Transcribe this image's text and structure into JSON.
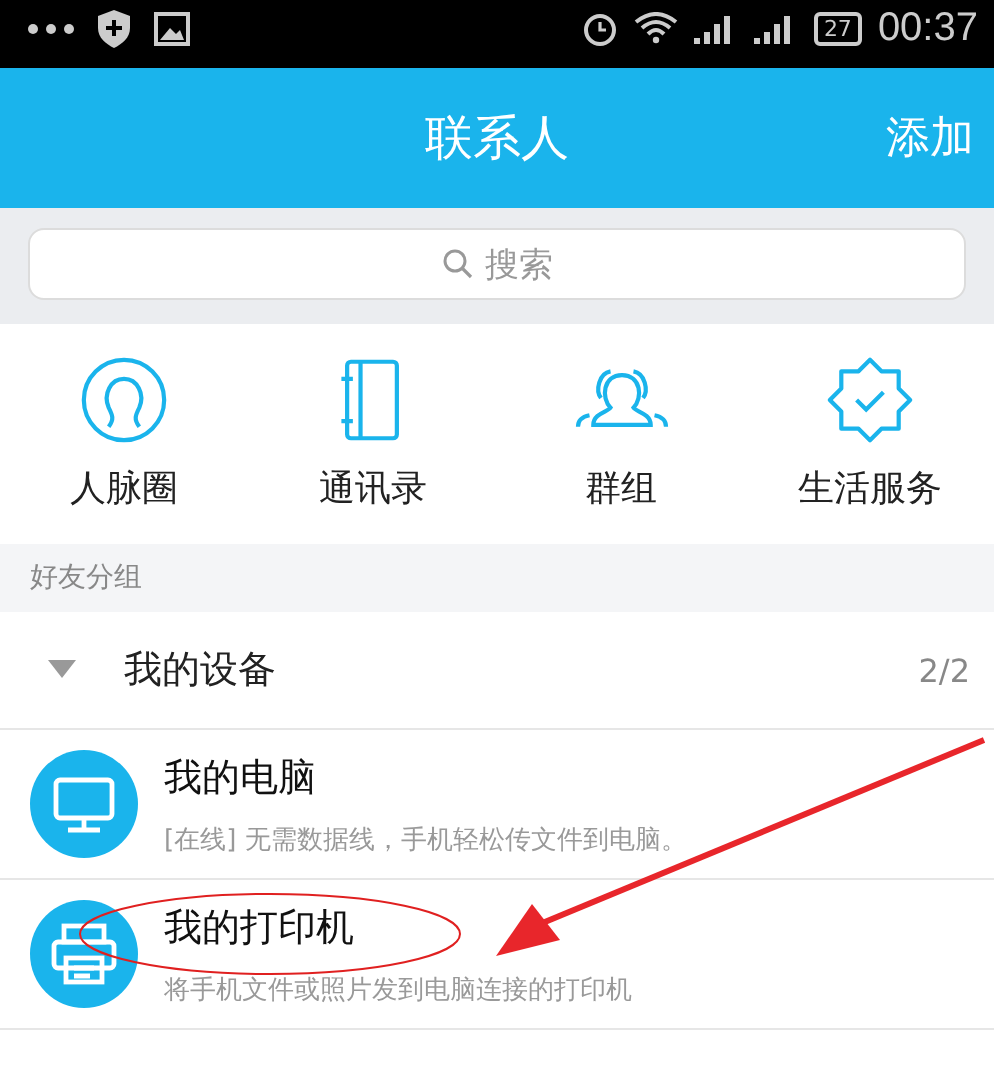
{
  "status_bar": {
    "battery": "27",
    "time": "00:37"
  },
  "header": {
    "title": "联系人",
    "action": "添加"
  },
  "search": {
    "placeholder": "搜索"
  },
  "shortcuts": [
    {
      "kind": "circle",
      "label": "人脉圈"
    },
    {
      "kind": "book",
      "label": "通讯录"
    },
    {
      "kind": "group",
      "label": "群组"
    },
    {
      "kind": "badge",
      "label": "生活服务"
    }
  ],
  "section_label": "好友分组",
  "group": {
    "name": "我的设备",
    "count": "2/2",
    "expanded": true
  },
  "devices": [
    {
      "kind": "computer",
      "name": "我的电脑",
      "description": "[在线] 无需数据线，手机轻松传文件到电脑。"
    },
    {
      "kind": "printer",
      "name": "我的打印机",
      "description": "将手机文件或照片发到电脑连接的打印机"
    }
  ]
}
